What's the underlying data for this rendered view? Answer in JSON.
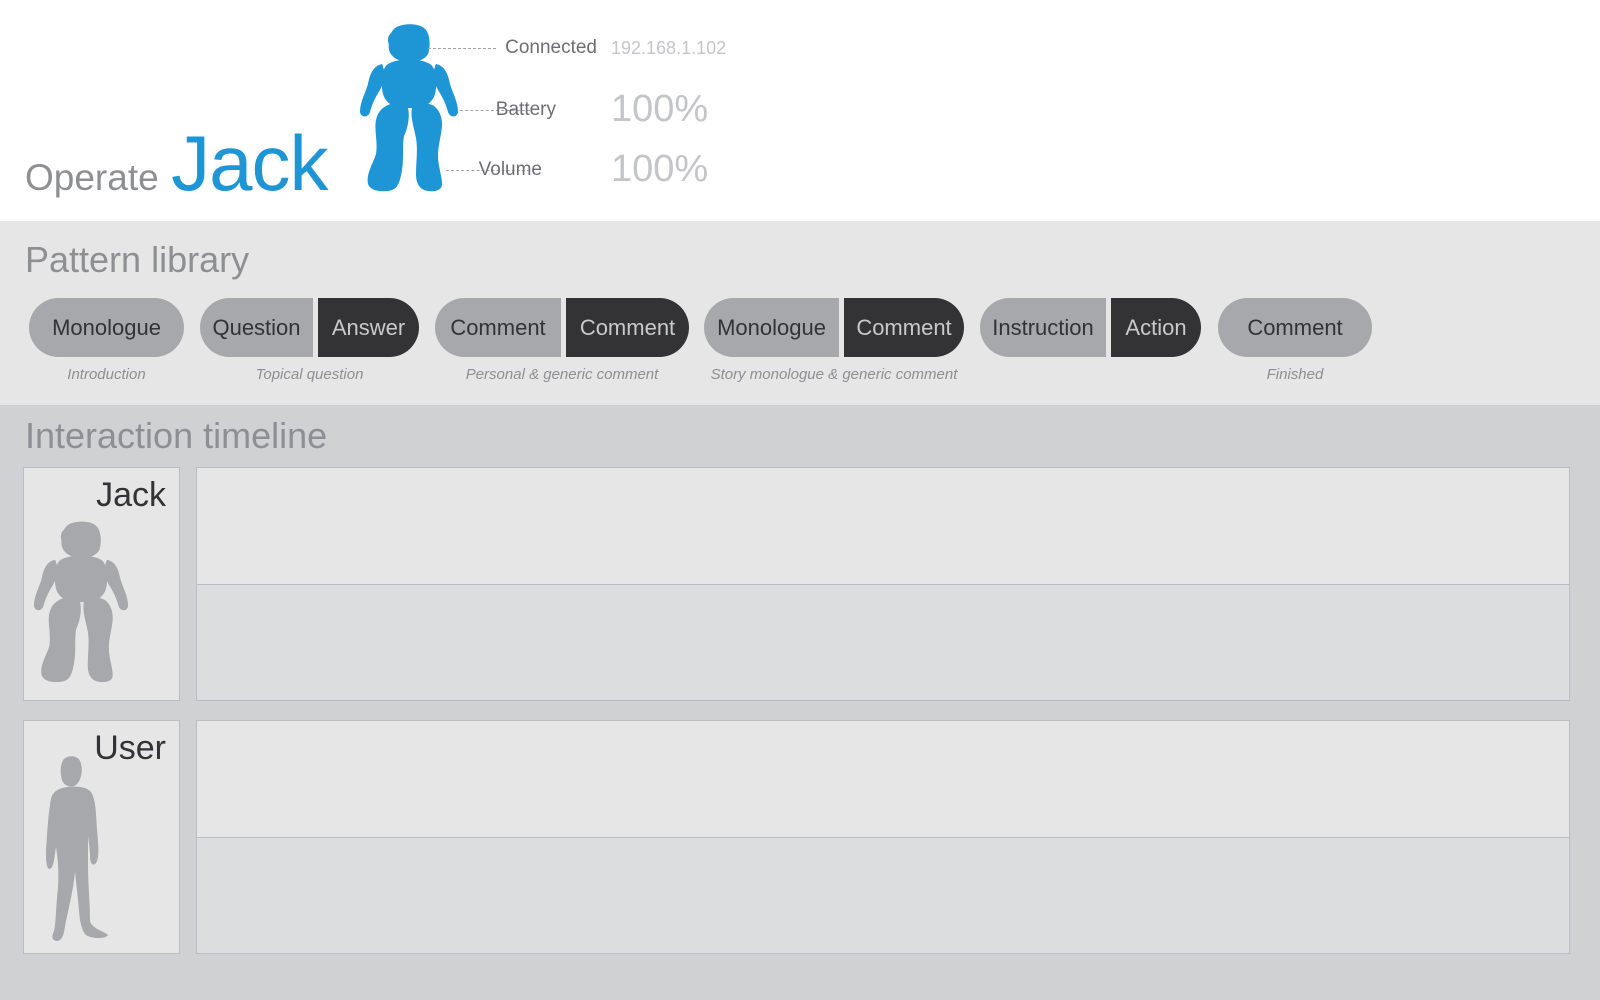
{
  "header": {
    "title_prefix": "Operate",
    "robot_name": "Jack",
    "status": [
      {
        "label": "Connected",
        "value": "192.168.1.102"
      },
      {
        "label": "Battery",
        "value": "100%"
      },
      {
        "label": "Volume",
        "value": "100%"
      }
    ],
    "icons": {
      "robot": "robot-icon",
      "user": "user-silhouette-icon"
    },
    "colors": {
      "accent": "#1e95d4",
      "pill_light": "#a7a8ab",
      "pill_dark": "#333335"
    }
  },
  "library": {
    "title": "Pattern library",
    "patterns": [
      {
        "segments": [
          "Monologue"
        ],
        "caption": "Introduction"
      },
      {
        "segments": [
          "Question",
          "Answer"
        ],
        "caption": "Topical question"
      },
      {
        "segments": [
          "Comment",
          "Comment"
        ],
        "caption": "Personal & generic comment"
      },
      {
        "segments": [
          "Monologue",
          "Comment"
        ],
        "caption": "Story monologue & generic comment"
      },
      {
        "segments": [
          "Instruction",
          "Action"
        ],
        "caption": ""
      },
      {
        "segments": [
          "Comment"
        ],
        "caption": "Finished"
      }
    ]
  },
  "timeline": {
    "title": "Interaction timeline",
    "actors": [
      {
        "name": "Jack"
      },
      {
        "name": "User"
      }
    ]
  }
}
